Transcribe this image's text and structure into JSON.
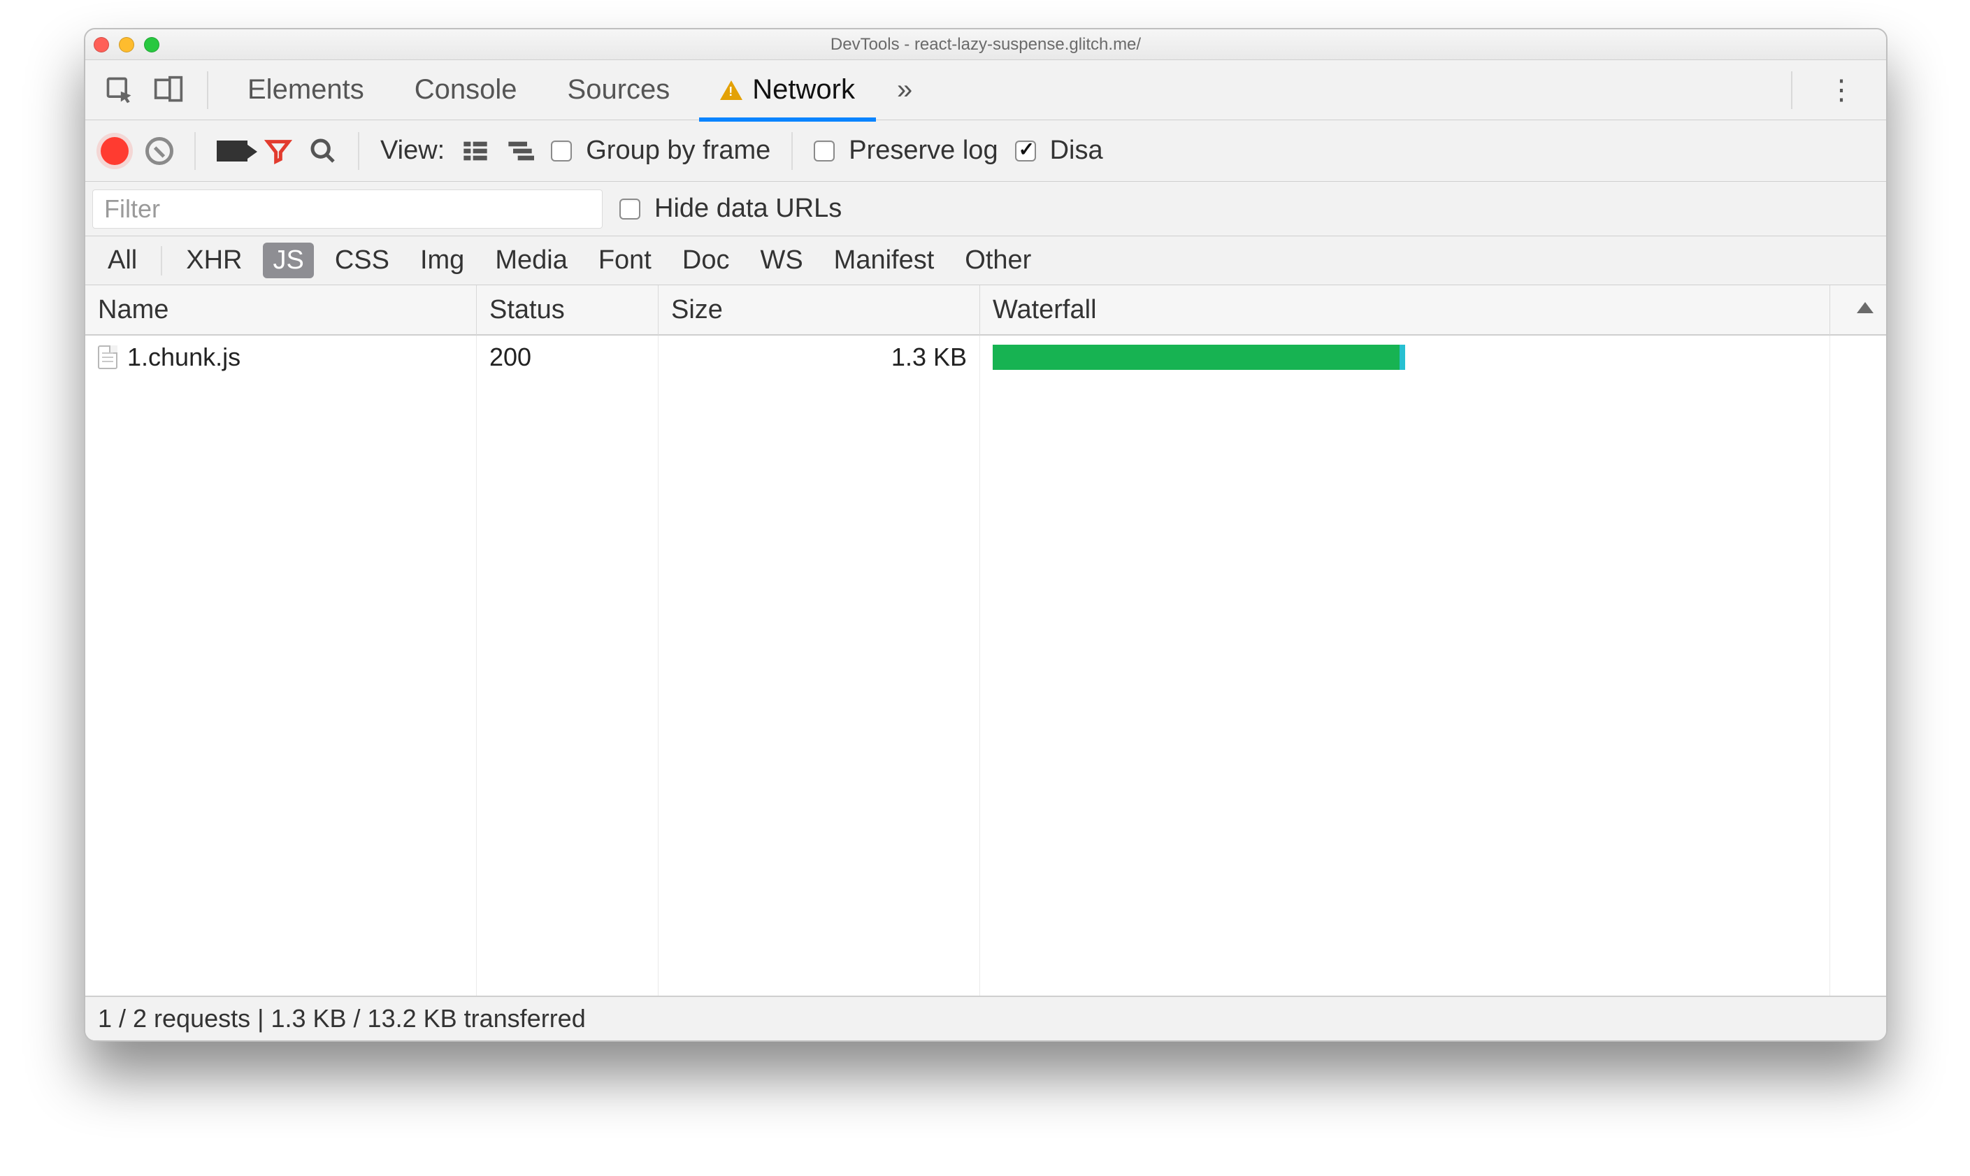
{
  "titlebar": {
    "title": "DevTools - react-lazy-suspense.glitch.me/"
  },
  "tabs": {
    "items": [
      {
        "label": "Elements"
      },
      {
        "label": "Console"
      },
      {
        "label": "Sources"
      },
      {
        "label": "Network",
        "active": true,
        "warning": true
      }
    ],
    "overflow_glyph": "»"
  },
  "toolbar": {
    "view_label": "View:",
    "group_by_frame_label": "Group by frame",
    "preserve_log_label": "Preserve log",
    "disable_cache_label": "Disa",
    "preserve_log_checked": false,
    "group_by_frame_checked": false,
    "disable_cache_checked": true
  },
  "filterbar": {
    "filter_placeholder": "Filter",
    "hide_data_urls_label": "Hide data URLs"
  },
  "types": {
    "items": [
      "All",
      "XHR",
      "JS",
      "CSS",
      "Img",
      "Media",
      "Font",
      "Doc",
      "WS",
      "Manifest",
      "Other"
    ],
    "selected": "JS"
  },
  "table": {
    "columns": {
      "name": "Name",
      "status": "Status",
      "size": "Size",
      "waterfall": "Waterfall"
    },
    "rows": [
      {
        "name": "1.chunk.js",
        "status": "200",
        "size": "1.3 KB",
        "waterfall_pct": 50
      }
    ]
  },
  "statusbar": {
    "text": "1 / 2 requests | 1.3 KB / 13.2 KB transferred"
  }
}
